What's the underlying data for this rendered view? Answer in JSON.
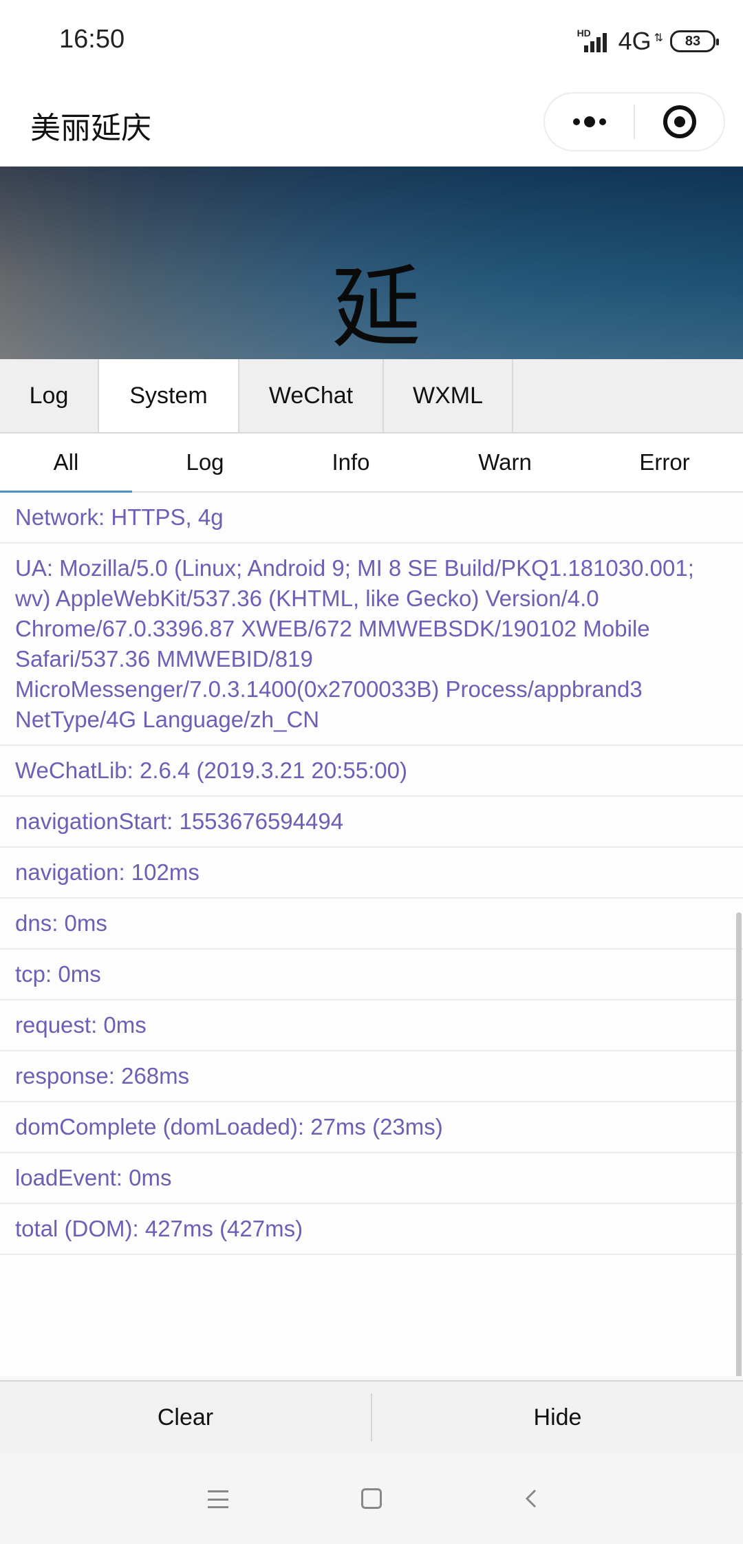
{
  "status_bar": {
    "time": "16:50",
    "hd_label": "HD",
    "network": "4G",
    "network_arrows": "⇅",
    "battery": "83"
  },
  "navbar": {
    "title": "美丽延庆"
  },
  "banner": {
    "glyph": "延"
  },
  "tabs": [
    {
      "label": "Log",
      "active": false
    },
    {
      "label": "System",
      "active": true
    },
    {
      "label": "WeChat",
      "active": false
    },
    {
      "label": "WXML",
      "active": false
    }
  ],
  "subtabs": [
    {
      "label": "All",
      "active": true
    },
    {
      "label": "Log",
      "active": false
    },
    {
      "label": "Info",
      "active": false
    },
    {
      "label": "Warn",
      "active": false
    },
    {
      "label": "Error",
      "active": false
    }
  ],
  "logs": [
    "Network: HTTPS, 4g",
    "UA: Mozilla/5.0 (Linux; Android 9; MI 8 SE Build/PKQ1.181030.001; wv) AppleWebKit/537.36 (KHTML, like Gecko) Version/4.0 Chrome/67.0.3396.87 XWEB/672 MMWEBSDK/190102 Mobile Safari/537.36 MMWEBID/819 MicroMessenger/7.0.3.1400(0x2700033B) Process/appbrand3 NetType/4G Language/zh_CN",
    "WeChatLib: 2.6.4 (2019.3.21 20:55:00)",
    "navigationStart: 1553676594494",
    "navigation: 102ms",
    "dns: 0ms",
    "tcp: 0ms",
    "request: 0ms",
    "response: 268ms",
    "domComplete (domLoaded): 27ms (23ms)",
    "loadEvent: 0ms",
    "total (DOM): 427ms (427ms)"
  ],
  "toolbar": {
    "clear_label": "Clear",
    "hide_label": "Hide"
  },
  "colors": {
    "log_text": "#6c5fb5",
    "active_underline": "#4a90c0"
  }
}
